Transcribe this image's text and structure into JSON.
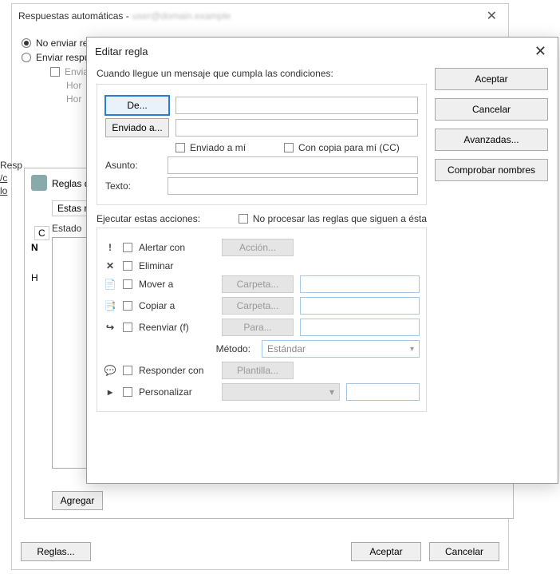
{
  "bg": {
    "title": "Respuestas automáticas -",
    "email_blur": "user@domain.example",
    "radio_no_send": "No enviar respuestas automáticas",
    "radio_send": "Enviar respuestas automáticas",
    "chk_envia": "Envia",
    "hor1": "Hor",
    "hor2": "Hor",
    "resp_link_prefix": "Resp",
    "link_text": "/c",
    "link_lo": "lo",
    "rules_title": "Reglas de",
    "rules_desc": "Estas reglas",
    "estado": "Estado",
    "col_c": "C",
    "col_n": "N",
    "col_h": "H",
    "agregar_btn": "Agregar",
    "reglas_btn": "Reglas...",
    "aceptar_btn": "Aceptar",
    "cancelar_btn": "Cancelar"
  },
  "fg": {
    "title": "Editar regla",
    "cond_label": "Cuando llegue un mensaje que cumpla las condiciones:",
    "de_btn": "De...",
    "enviado_btn": "Enviado a...",
    "chk_enviado_ami": "Enviado a mí",
    "chk_cc": "Con copia para mí (CC)",
    "asunto_label": "Asunto:",
    "texto_label": "Texto:",
    "right_buttons": {
      "aceptar": "Aceptar",
      "cancelar": "Cancelar",
      "avanzadas": "Avanzadas...",
      "comprobar": "Comprobar nombres"
    },
    "actions_label": "Ejecutar estas acciones:",
    "chk_no_procesar": "No procesar las reglas que siguen a ésta",
    "actions": {
      "alertar": "Alertar con",
      "accion_btn": "Acción...",
      "eliminar": "Eliminar",
      "mover": "Mover a",
      "carpeta_btn": "Carpeta...",
      "copiar": "Copiar a",
      "reenviar": "Reenviar (f)",
      "para_btn": "Para...",
      "metodo_label": "Método:",
      "metodo_value": "Estándar",
      "responder": "Responder con",
      "plantilla_btn": "Plantilla...",
      "personalizar": "Personalizar"
    }
  }
}
